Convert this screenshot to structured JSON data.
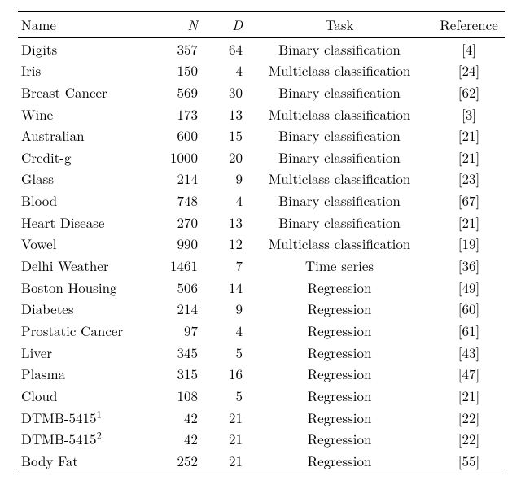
{
  "columns": {
    "name": "Name",
    "n": "N",
    "d": "D",
    "task": "Task",
    "ref": "Reference"
  },
  "rows": [
    {
      "name": "Digits",
      "sup": "",
      "n": "357",
      "d": "64",
      "task": "Binary classification",
      "ref": "[4]"
    },
    {
      "name": "Iris",
      "sup": "",
      "n": "150",
      "d": "4",
      "task": "Multiclass classification",
      "ref": "[24]"
    },
    {
      "name": "Breast Cancer",
      "sup": "",
      "n": "569",
      "d": "30",
      "task": "Binary classification",
      "ref": "[62]"
    },
    {
      "name": "Wine",
      "sup": "",
      "n": "173",
      "d": "13",
      "task": "Multiclass classification",
      "ref": "[3]"
    },
    {
      "name": "Australian",
      "sup": "",
      "n": "600",
      "d": "15",
      "task": "Binary classification",
      "ref": "[21]"
    },
    {
      "name": "Credit-g",
      "sup": "",
      "n": "1000",
      "d": "20",
      "task": "Binary classification",
      "ref": "[21]"
    },
    {
      "name": "Glass",
      "sup": "",
      "n": "214",
      "d": "9",
      "task": "Multiclass classification",
      "ref": "[23]"
    },
    {
      "name": "Blood",
      "sup": "",
      "n": "748",
      "d": "4",
      "task": "Binary classification",
      "ref": "[67]"
    },
    {
      "name": "Heart Disease",
      "sup": "",
      "n": "270",
      "d": "13",
      "task": "Binary classification",
      "ref": "[21]"
    },
    {
      "name": "Vowel",
      "sup": "",
      "n": "990",
      "d": "12",
      "task": "Multiclass classification",
      "ref": "[19]"
    },
    {
      "name": "Delhi Weather",
      "sup": "",
      "n": "1461",
      "d": "7",
      "task": "Time series",
      "ref": "[36]"
    },
    {
      "name": "Boston Housing",
      "sup": "",
      "n": "506",
      "d": "14",
      "task": "Regression",
      "ref": "[49]"
    },
    {
      "name": "Diabetes",
      "sup": "",
      "n": "214",
      "d": "9",
      "task": "Regression",
      "ref": "[60]"
    },
    {
      "name": "Prostatic Cancer",
      "sup": "",
      "n": "97",
      "d": "4",
      "task": "Regression",
      "ref": "[61]"
    },
    {
      "name": "Liver",
      "sup": "",
      "n": "345",
      "d": "5",
      "task": "Regression",
      "ref": "[43]"
    },
    {
      "name": "Plasma",
      "sup": "",
      "n": "315",
      "d": "16",
      "task": "Regression",
      "ref": "[47]"
    },
    {
      "name": "Cloud",
      "sup": "",
      "n": "108",
      "d": "5",
      "task": "Regression",
      "ref": "[21]"
    },
    {
      "name": "DTMB-5415",
      "sup": "1",
      "n": "42",
      "d": "21",
      "task": "Regression",
      "ref": "[22]"
    },
    {
      "name": "DTMB-5415",
      "sup": "2",
      "n": "42",
      "d": "21",
      "task": "Regression",
      "ref": "[22]"
    },
    {
      "name": "Body Fat",
      "sup": "",
      "n": "252",
      "d": "21",
      "task": "Regression",
      "ref": "[55]"
    }
  ]
}
